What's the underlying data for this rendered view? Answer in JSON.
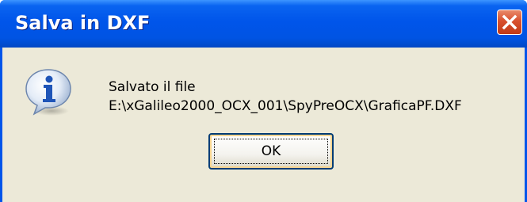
{
  "window": {
    "title": "Salva in DXF",
    "close_icon": "close-icon"
  },
  "dialog": {
    "icon": "info-icon",
    "message_line1": "Salvato il file",
    "message_line2": "E:\\xGalileo2000_OCX_001\\SpyPreOCX\\GraficaPF.DXF",
    "ok_label": "OK"
  },
  "colors": {
    "titlebar": "#0055ea",
    "close_button": "#d8502e",
    "dialog_background": "#ece9d8"
  }
}
